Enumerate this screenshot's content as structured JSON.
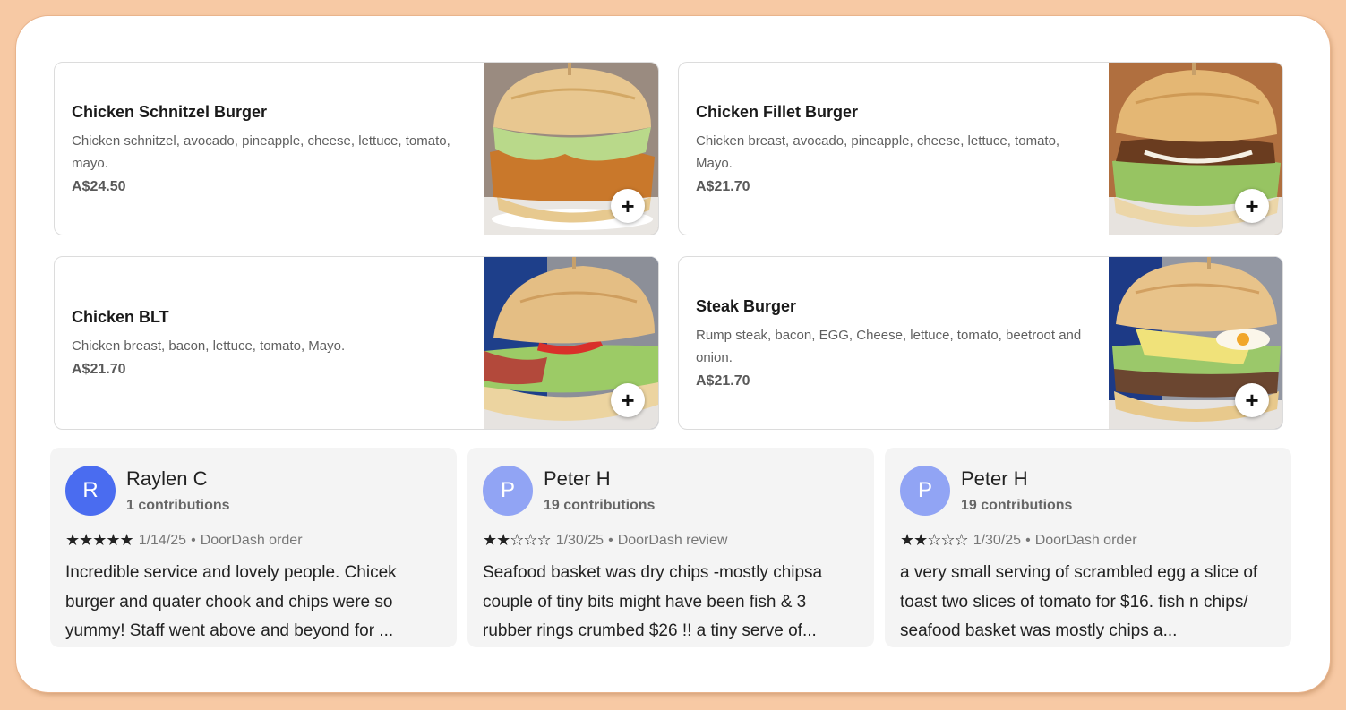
{
  "menu": {
    "items": [
      {
        "name": "Chicken Schnitzel Burger",
        "description": "Chicken schnitzel, avocado, pineapple, cheese, lettuce, tomato, mayo.",
        "price": "A$24.50",
        "add_label": "+",
        "image_icon": "burger-photo"
      },
      {
        "name": "Chicken Fillet Burger",
        "description": "Chicken breast, avocado, pineapple, cheese, lettuce, tomato, Mayo.",
        "price": "A$21.70",
        "add_label": "+",
        "image_icon": "burger-photo"
      },
      {
        "name": "Chicken BLT",
        "description": "Chicken breast, bacon, lettuce, tomato, Mayo.",
        "price": "A$21.70",
        "add_label": "+",
        "image_icon": "burger-photo"
      },
      {
        "name": "Steak Burger",
        "description": "Rump steak, bacon, EGG, Cheese, lettuce, tomato, beetroot and onion.",
        "price": "A$21.70",
        "add_label": "+",
        "image_icon": "burger-photo"
      }
    ]
  },
  "reviews": [
    {
      "initial": "R",
      "name": "Raylen C",
      "contributions": "1 contributions",
      "rating": 5,
      "stars": "★★★★★",
      "date": "1/14/25",
      "source": "DoorDash order",
      "text": "Incredible service and lovely people. Chicek burger and quater chook and chips were so yummy! Staff went above and beyond for ...",
      "avatar_color": "#4a6cf0"
    },
    {
      "initial": "P",
      "name": "Peter H",
      "contributions": "19 contributions",
      "rating": 2,
      "stars": "★★☆☆☆",
      "date": "1/30/25",
      "source": "DoorDash review",
      "text": "Seafood basket was dry chips -mostly chipsa couple of tiny bits might have been fish & 3 rubber rings crumbed $26 !! a tiny serve of...",
      "avatar_color": "#91a4f4"
    },
    {
      "initial": "P",
      "name": "Peter H",
      "contributions": "19 contributions",
      "rating": 2,
      "stars": "★★☆☆☆",
      "date": "1/30/25",
      "source": "DoorDash order",
      "text": "a very small serving of scrambled egg a slice of toast two slices of tomato for $16. fish n chips/ seafood basket was mostly chips a...",
      "avatar_color": "#91a4f4"
    }
  ],
  "separator": "•"
}
